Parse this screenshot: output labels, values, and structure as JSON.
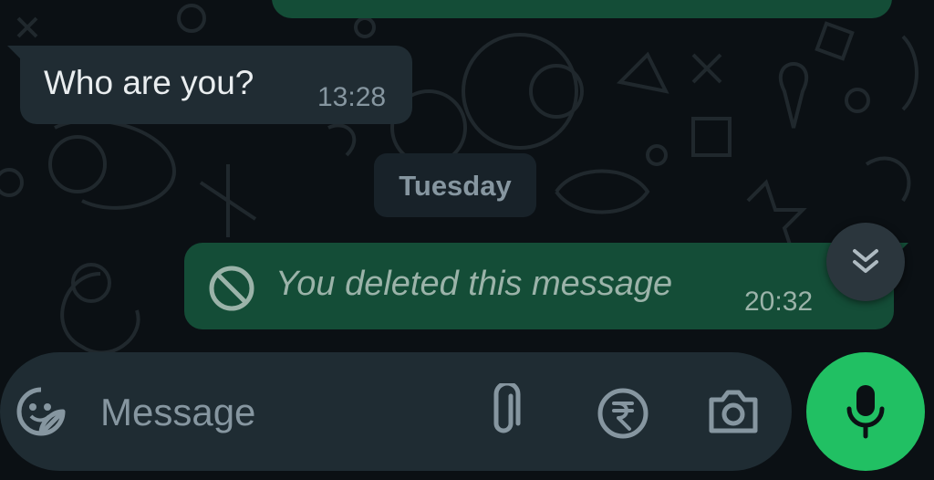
{
  "colors": {
    "background": "#0b1014",
    "incoming_bubble": "#202c33",
    "outgoing_bubble": "#144d37",
    "composer": "#1f2c33",
    "accent_green": "#21c063",
    "muted_text": "#8696a0"
  },
  "messages": [
    {
      "direction": "incoming",
      "text": "Who are you?",
      "time": "13:28"
    },
    {
      "direction": "outgoing",
      "text": "You deleted this message",
      "time": "20:32",
      "deleted": true,
      "icon": "ban-icon"
    }
  ],
  "date_separator": "Tuesday",
  "composer": {
    "placeholder": "Message",
    "icons": [
      "sticker-icon",
      "attachment-icon",
      "rupee-payment-icon",
      "camera-icon"
    ]
  },
  "buttons": {
    "scroll_down_icon": "double-chevron-down-icon",
    "mic_icon": "microphone-icon"
  }
}
